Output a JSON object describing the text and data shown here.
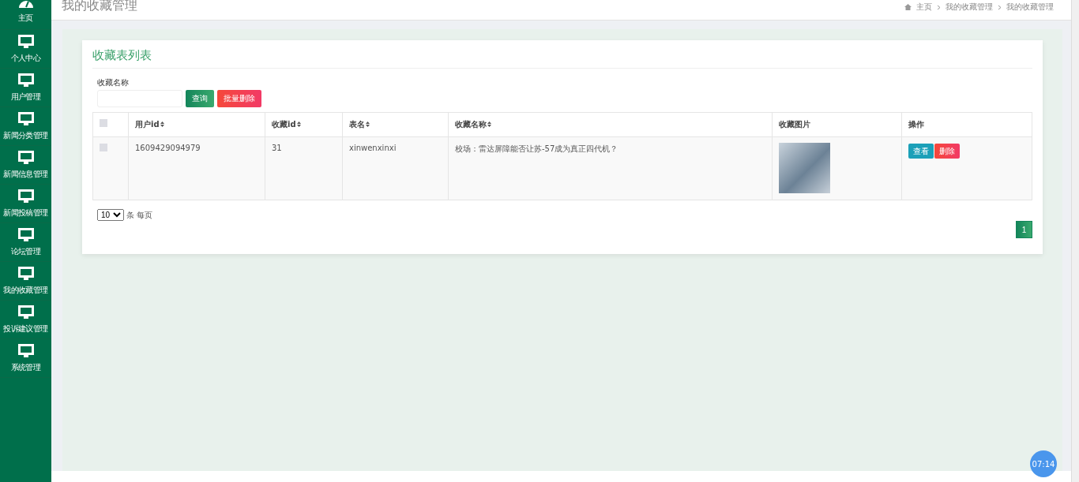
{
  "sidebar": {
    "items": [
      {
        "label": "主页",
        "kind": "home",
        "selected": false
      },
      {
        "label": "个人中心",
        "kind": "module",
        "selected": false
      },
      {
        "label": "用户管理",
        "kind": "module",
        "selected": false
      },
      {
        "label": "新闻分类管理",
        "kind": "module",
        "selected": false
      },
      {
        "label": "新闻信息管理",
        "kind": "module",
        "selected": false
      },
      {
        "label": "新闻投稿管理",
        "kind": "module",
        "selected": false
      },
      {
        "label": "论坛管理",
        "kind": "module",
        "selected": false
      },
      {
        "label": "我的收藏管理",
        "kind": "module",
        "selected": false
      },
      {
        "label": "投诉建议管理",
        "kind": "module",
        "selected": false
      },
      {
        "label": "系统管理",
        "kind": "module",
        "selected": false
      }
    ]
  },
  "header": {
    "title": "我的收藏管理",
    "breadcrumb": [
      "主页",
      "我的收藏管理",
      "我的收藏管理"
    ]
  },
  "card": {
    "title": "收藏表列表",
    "search": {
      "label": "收藏名称",
      "buttons": [
        {
          "label": "查询",
          "kind": "primary"
        },
        {
          "label": "批量删除",
          "kind": "danger"
        }
      ]
    },
    "table": {
      "header_checked": false,
      "columns": [
        {
          "label": "用户id",
          "sortable": true
        },
        {
          "label": "收藏id",
          "sortable": true
        },
        {
          "label": "表名",
          "sortable": true
        },
        {
          "label": "收藏名称",
          "sortable": true
        },
        {
          "label": "收藏图片",
          "sortable": false
        },
        {
          "label": "操作",
          "sortable": false
        }
      ],
      "rows": [
        {
          "checked": false,
          "user_id": "1609429094979",
          "fav_id": "31",
          "table_name": "xinwenxinxi",
          "fav_name": "校场：雷达屏障能否让苏-57成为真正四代机？",
          "actions": [
            {
              "label": "查看",
              "kind": "info"
            },
            {
              "label": "删除",
              "kind": "danger"
            }
          ]
        }
      ]
    },
    "page_size": {
      "value": "10",
      "label": "条 每页"
    },
    "pages": [
      {
        "label": "1",
        "selected": true
      }
    ]
  },
  "timer_badge": "07:14"
}
